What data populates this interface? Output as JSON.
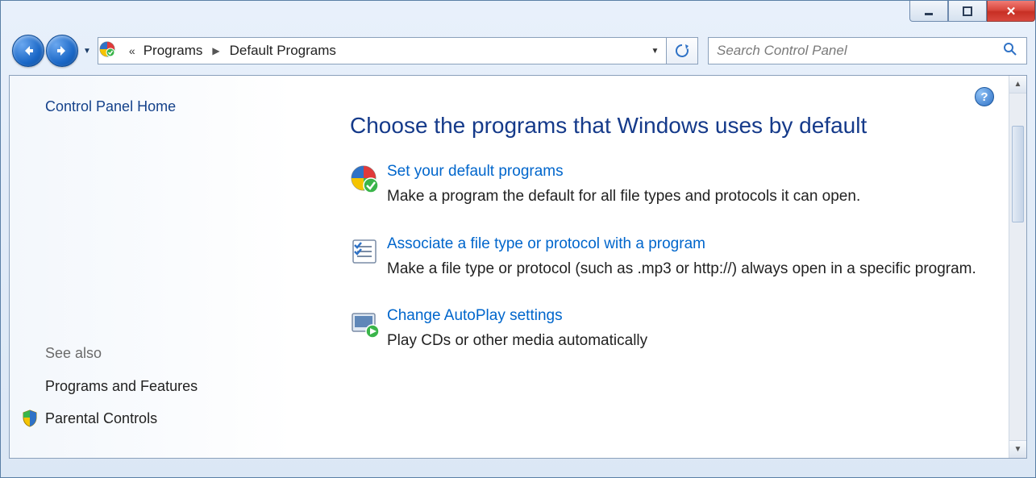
{
  "window_controls": {
    "minimize": "–",
    "maximize": "❐",
    "close": "✕"
  },
  "nav": {
    "back_label": "Back",
    "forward_label": "Forward"
  },
  "breadcrumb": {
    "seg1": "Programs",
    "seg2": "Default Programs"
  },
  "search": {
    "placeholder": "Search Control Panel"
  },
  "sidebar": {
    "home": "Control Panel Home",
    "see_also": "See also",
    "programs_and_features": "Programs and Features",
    "parental_controls": "Parental Controls"
  },
  "main": {
    "title": "Choose the programs that Windows uses by default",
    "options": [
      {
        "link": "Set your default programs",
        "desc": "Make a program the default for all file types and protocols it can open."
      },
      {
        "link": "Associate a file type or protocol with a program",
        "desc": "Make a file type or protocol (such as .mp3 or http://) always open in a specific program."
      },
      {
        "link": "Change AutoPlay settings",
        "desc": "Play CDs or other media automatically"
      }
    ]
  },
  "help_glyph": "?"
}
